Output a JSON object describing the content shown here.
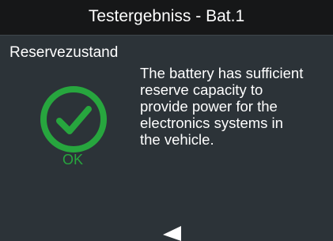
{
  "header": {
    "title": "Testergebniss - Bat.1"
  },
  "result": {
    "section_title": "Reservezustand",
    "status": "OK",
    "icon": "check-circle-icon",
    "status_color": "#27a63e",
    "message_lines": [
      "The battery has sufficient",
      "reserve capacity to",
      "provide power for the",
      "electronics systems in",
      "the vehicle."
    ]
  },
  "navigation": {
    "back_icon": "triangle-left-icon"
  },
  "colors": {
    "background": "#2c3338",
    "title_bar": "#161718",
    "text": "#ffffff",
    "success": "#27a63e"
  }
}
